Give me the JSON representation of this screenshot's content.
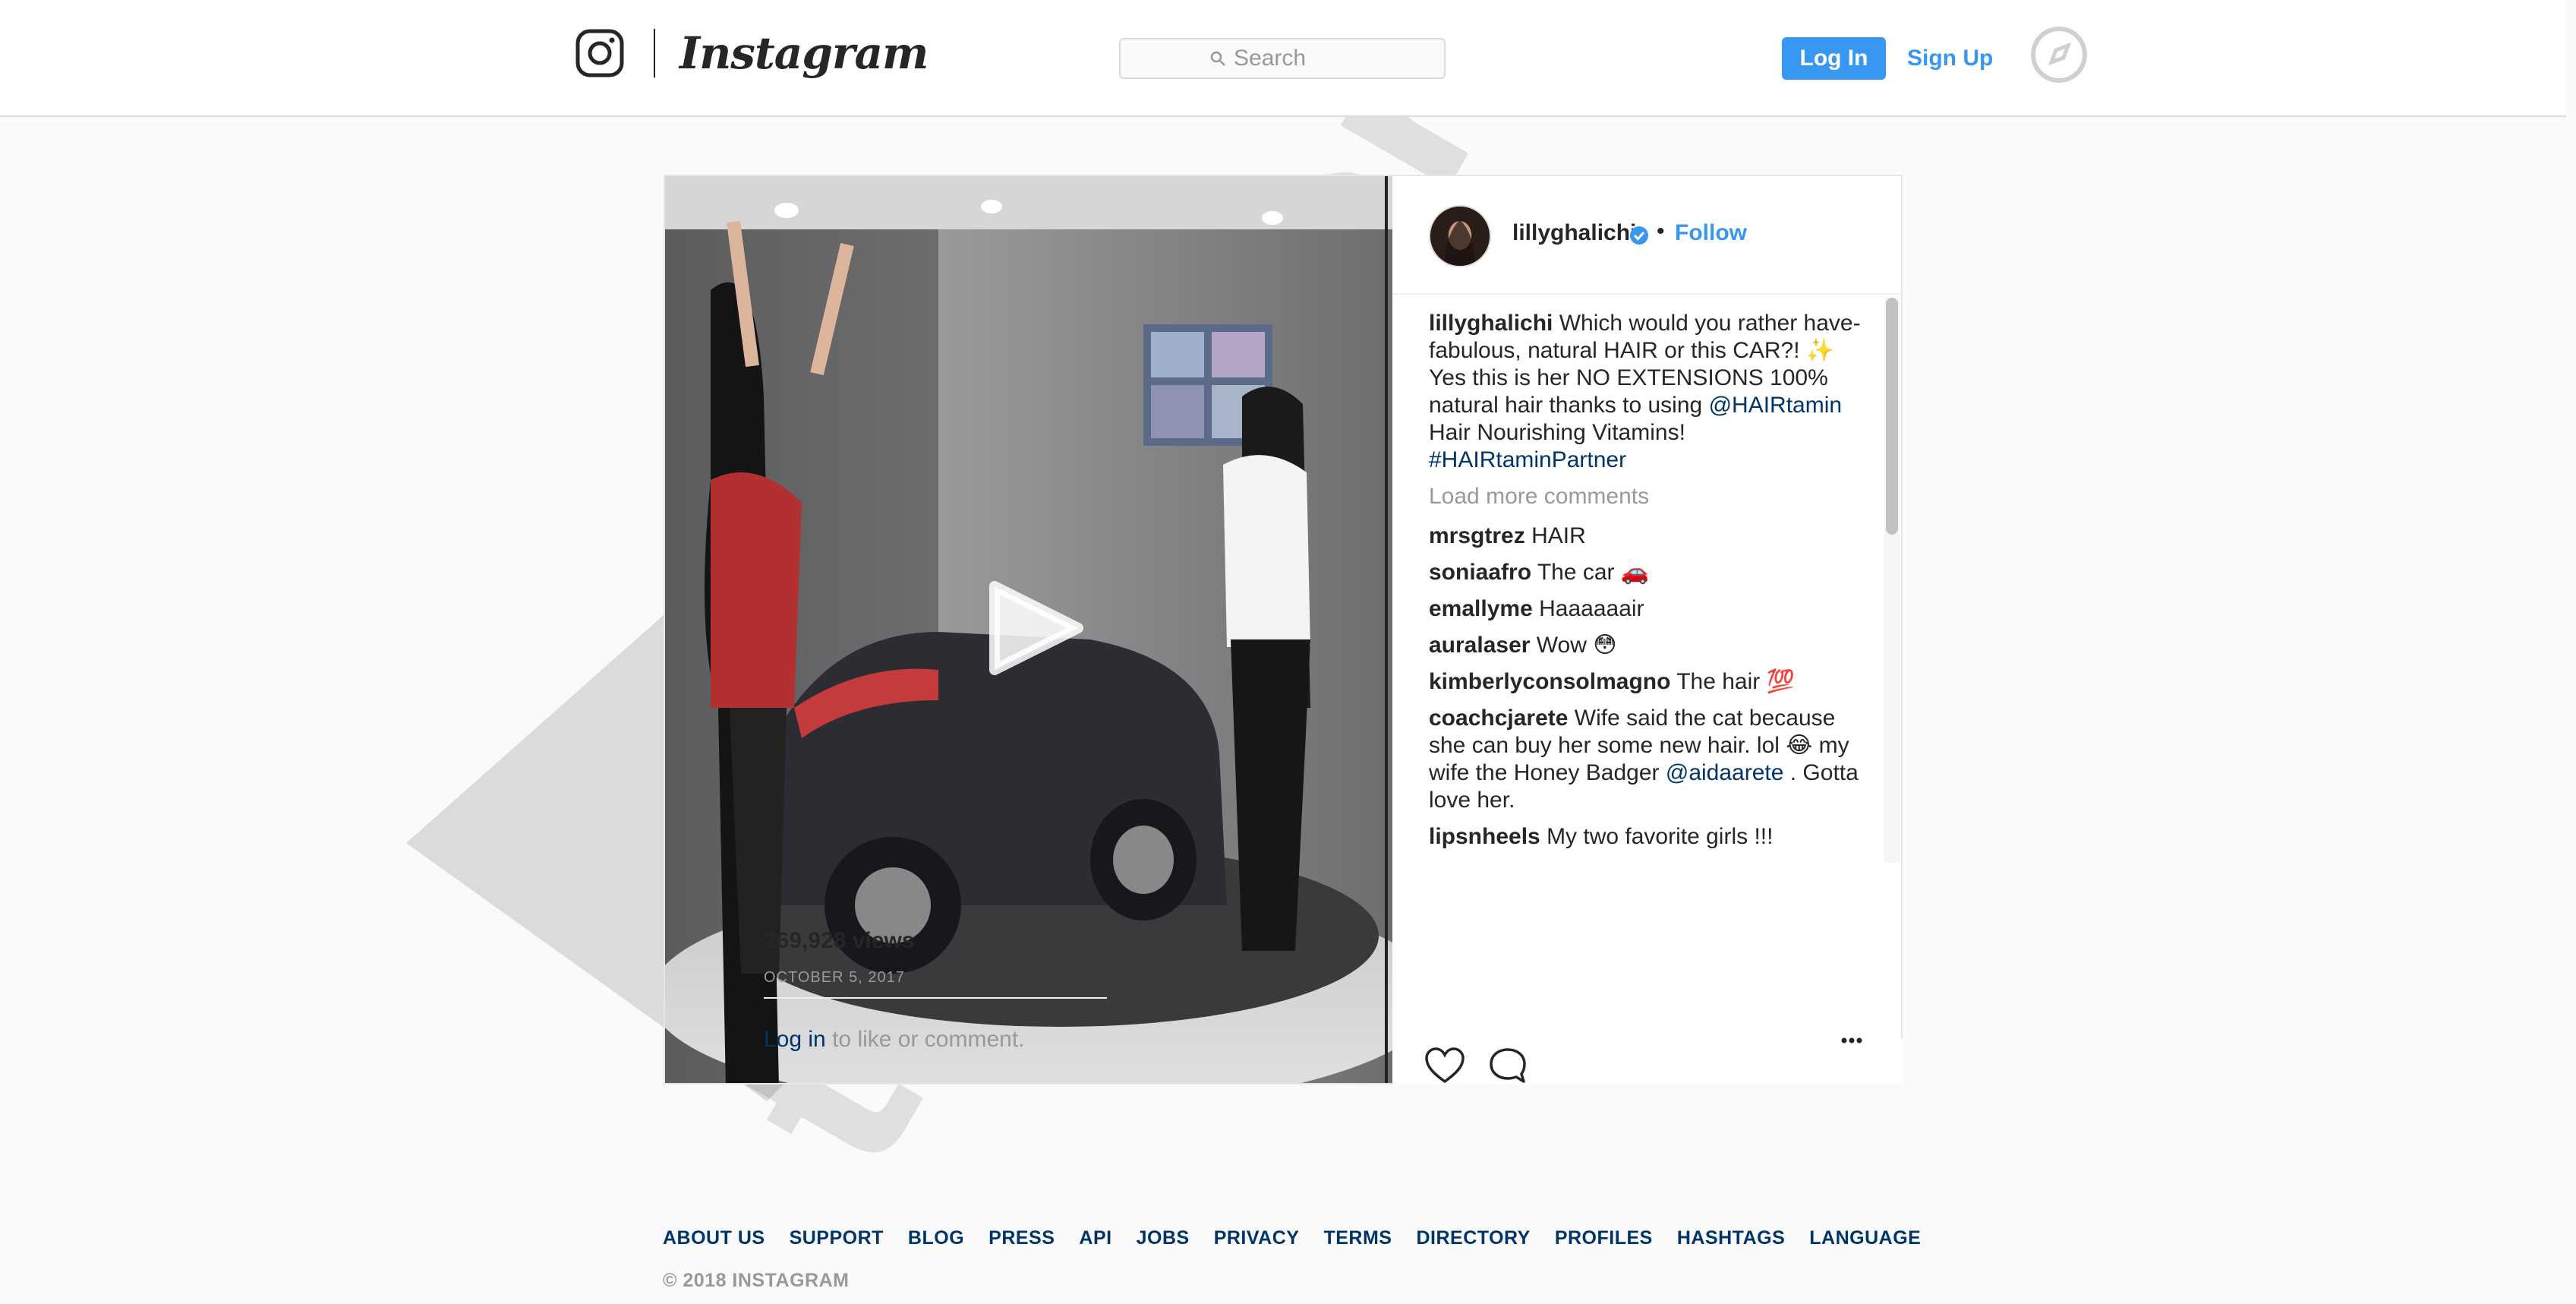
{
  "header": {
    "brand": "Instagram",
    "search_placeholder": "Search",
    "login_label": "Log In",
    "signup_label": "Sign Up",
    "icons": {
      "logo": "instagram-camera-icon",
      "search": "search-icon",
      "explore": "compass-icon"
    },
    "colors": {
      "accent": "#3897f0",
      "border": "#dbdbdb"
    }
  },
  "post": {
    "author": "lillyghalichi",
    "separator": "•",
    "follow_label": "Follow",
    "caption": {
      "username": "lillyghalichi",
      "text_1": "Which would you rather have- fabulous, natural HAIR or this CAR?! ✨  Yes this is her NO EXTENSIONS 100% natural hair thanks to using",
      "mention": "@HAIRtamin",
      "text_2": "Hair Nourishing Vitamins!",
      "hashtag": "#HAIRtaminPartner"
    },
    "load_more_label": "Load more comments",
    "comments": [
      {
        "username": "mrsgtrez",
        "text": "HAIR"
      },
      {
        "username": "soniaafro",
        "text": "The car 🚗"
      },
      {
        "username": "emallyme",
        "text": "Haaaaaair"
      },
      {
        "username": "auralaser",
        "text": "Wow 😳"
      },
      {
        "username": "kimberlyconsolmagno",
        "text": "The hair 💯"
      },
      {
        "username": "coachcjarete",
        "text": "Wife said the cat because she can buy her some new hair. lol 😂  my wife the Honey Badger",
        "mention": "@aidaarete",
        "text_after": ". Gotta love her."
      },
      {
        "username": "lipsnheels",
        "text": "My two favorite girls !!!"
      }
    ],
    "views": "269,928 views",
    "date": "OCTOBER 5, 2017",
    "login_link": "Log in",
    "login_suffix": "to like or comment.",
    "icons": {
      "play": "play-icon",
      "like": "heart-icon",
      "comment": "comment-icon",
      "verified": "verified-badge-icon",
      "more": "more-options-icon"
    }
  },
  "footer": {
    "links": [
      "ABOUT US",
      "SUPPORT",
      "BLOG",
      "PRESS",
      "API",
      "JOBS",
      "PRIVACY",
      "TERMS",
      "DIRECTORY",
      "PROFILES",
      "HASHTAGS",
      "LANGUAGE"
    ],
    "copyright": "© 2018 INSTAGRAM"
  }
}
